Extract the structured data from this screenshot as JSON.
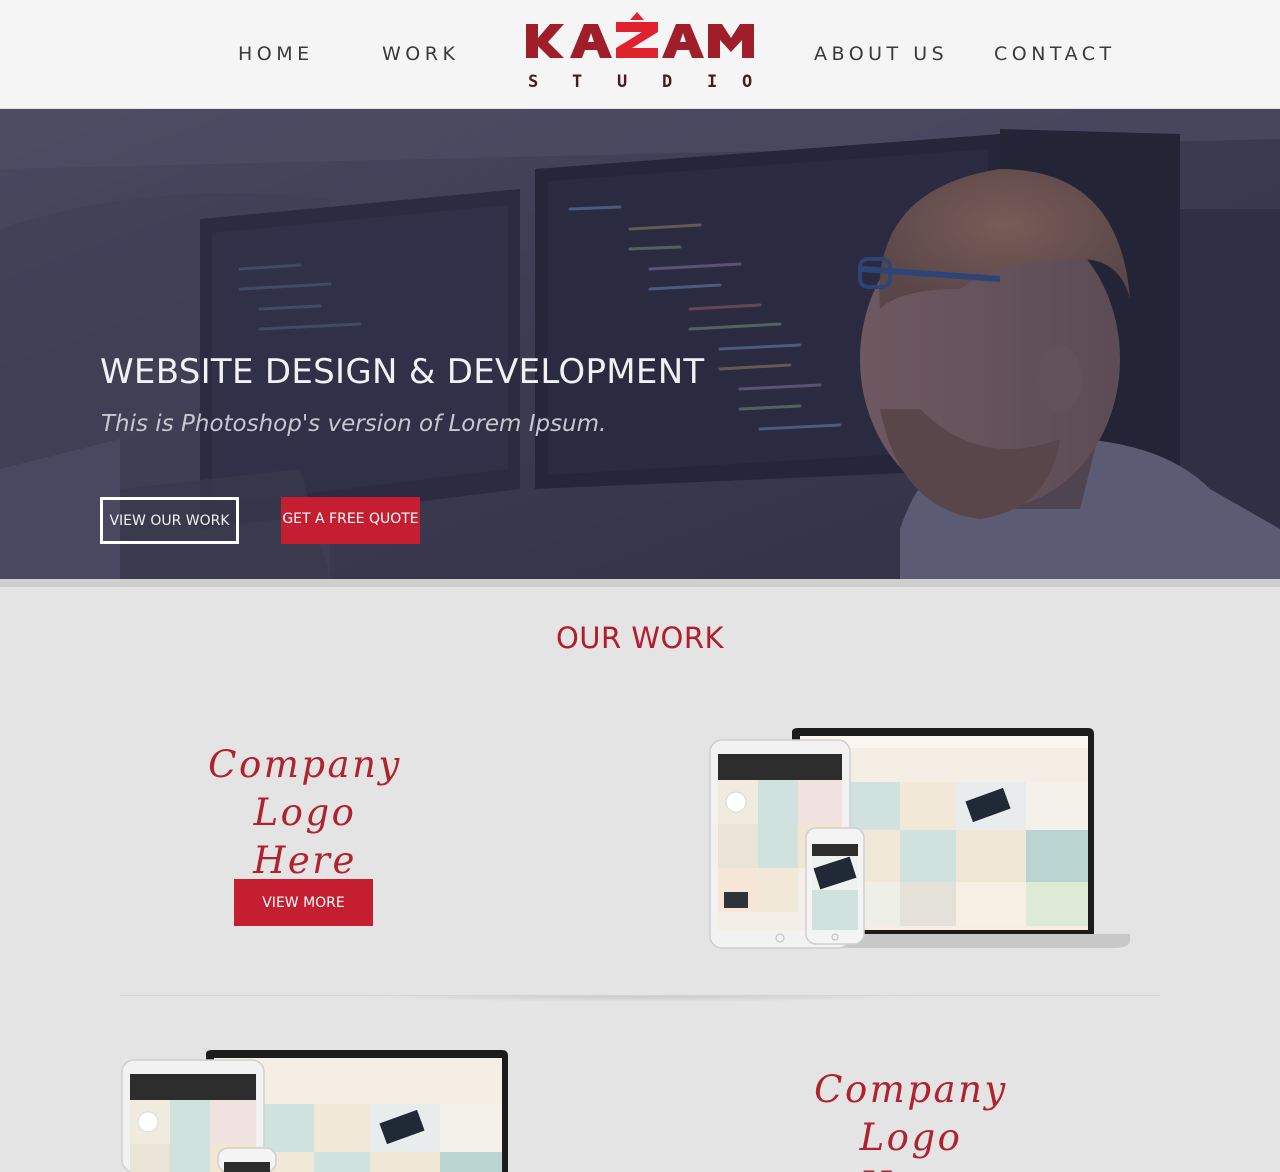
{
  "header": {
    "nav_left": [
      "HOME",
      "WORK"
    ],
    "nav_right": [
      "ABOUT US",
      "CONTACT"
    ],
    "logo": {
      "wordmark": "KAZAM",
      "subtitle": "STUDIO",
      "color": "#b0222e",
      "accent": "#e0222e"
    }
  },
  "hero": {
    "title": "WEBSITE DESIGN & DEVELOPMENT",
    "subtitle": "This is Photoshop's version  of Lorem Ipsum.",
    "btn_view_work": "VIEW OUR WORK",
    "btn_quote": "GET A FREE QUOTE",
    "overlay_color": "#3a3950",
    "accent": "#c41e30"
  },
  "work": {
    "title": "OUR WORK",
    "items": [
      {
        "company_line1": "Company Logo",
        "company_line2": "Here",
        "btn": "VIEW MORE"
      },
      {
        "company_line1": "Company Logo",
        "company_line2": "Here"
      }
    ]
  }
}
